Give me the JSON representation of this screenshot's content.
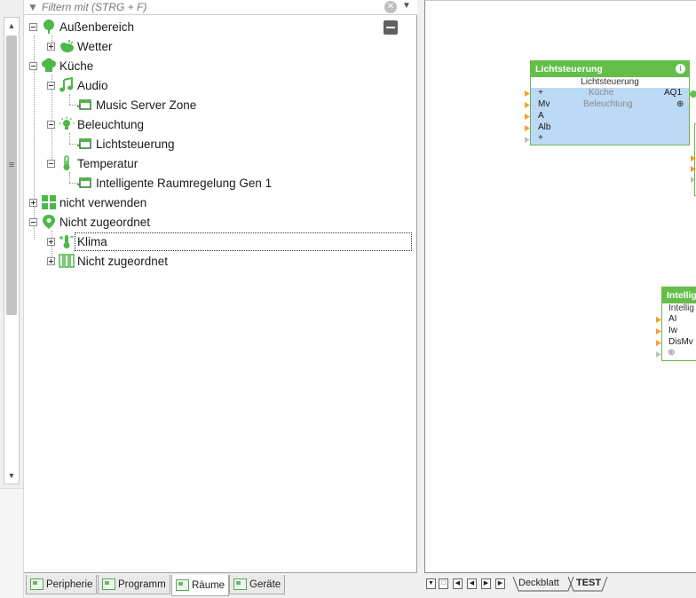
{
  "filter": {
    "placeholder": "Filtern mit (STRG + F)"
  },
  "tree": {
    "items": [
      {
        "label": "Außenbereich",
        "icon": "tree-icon"
      },
      {
        "label": "Wetter",
        "icon": "weather-icon"
      },
      {
        "label": "Küche",
        "icon": "chef-hat-icon"
      },
      {
        "label": "Audio",
        "icon": "music-note-icon"
      },
      {
        "label": "Music Server Zone",
        "icon": "block-icon"
      },
      {
        "label": "Beleuchtung",
        "icon": "lightbulb-icon"
      },
      {
        "label": "Lichtsteuerung",
        "icon": "block-icon"
      },
      {
        "label": "Temperatur",
        "icon": "thermometer-icon"
      },
      {
        "label": "Intelligente Raumregelung Gen 1",
        "icon": "block-icon"
      },
      {
        "label": "nicht verwenden",
        "icon": "grid-icon"
      },
      {
        "label": "Nicht zugeordnet",
        "icon": "location-pin-icon"
      },
      {
        "label": "Klima",
        "icon": "climate-icon"
      },
      {
        "label": "Nicht zugeordnet",
        "icon": "columns-icon"
      }
    ]
  },
  "left_tabs": [
    "Peripherie",
    "Programm",
    "Räume",
    "Geräte"
  ],
  "canvas": {
    "block1": {
      "title": "Lichtsteuerung",
      "subtitle": "Lichtsteuerung",
      "room": "Küche",
      "category": "Beleuchtung",
      "inputs": [
        "+",
        "Mv",
        "A",
        "Alb",
        "+"
      ],
      "output": "AQ1"
    },
    "block2": {
      "title": "Intellig",
      "subtitle": "Intellig",
      "inputs": [
        "AI",
        "Iw",
        "DisMv"
      ]
    }
  },
  "sheet_tabs": [
    "Deckblatt",
    "TEST"
  ],
  "colors": {
    "accent_green": "#63bf4a",
    "block_body": "#bcd9f5",
    "pin_orange": "#f0a030"
  }
}
